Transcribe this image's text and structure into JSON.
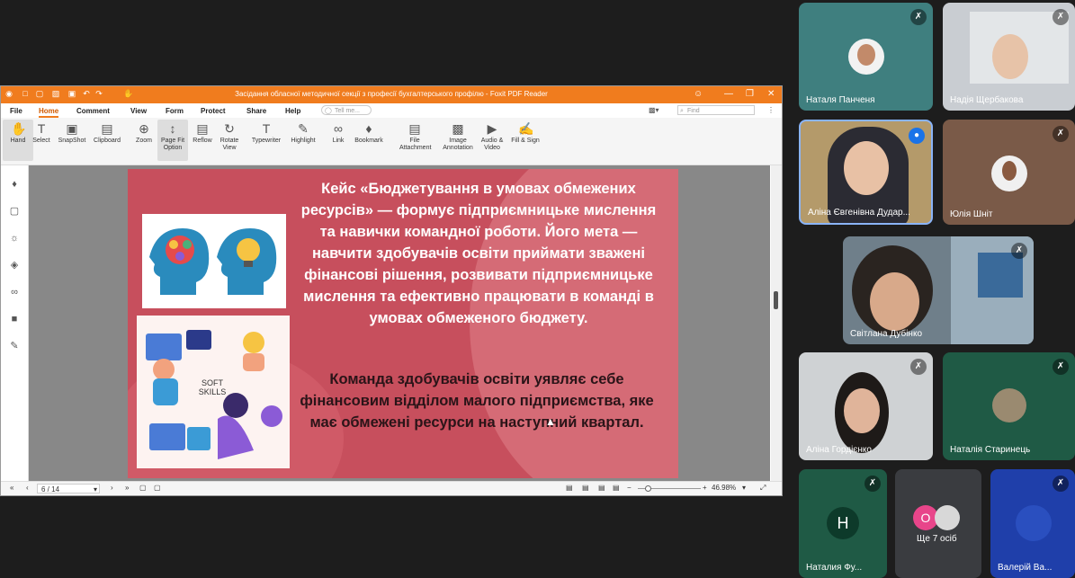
{
  "pdf": {
    "window_title": "Засідання обласної методичної секції з професії бухгалтерського профілю - Foxit PDF Reader",
    "menu": [
      "File",
      "Home",
      "Comment",
      "View",
      "Form",
      "Protect",
      "Share",
      "Help"
    ],
    "tell_me": "Tell me...",
    "find": "Find",
    "ribbon": [
      {
        "label": "Hand",
        "icon": "hand-icon"
      },
      {
        "label": "Select",
        "icon": "select-text-icon"
      },
      {
        "label": "SnapShot",
        "icon": "snapshot-icon"
      },
      {
        "label": "Clipboard",
        "icon": "clipboard-icon"
      },
      {
        "label": "Zoom",
        "icon": "zoom-icon"
      },
      {
        "label": "Page Fit Option",
        "icon": "page-fit-icon"
      },
      {
        "label": "Reflow",
        "icon": "reflow-icon"
      },
      {
        "label": "Rotate View",
        "icon": "rotate-icon"
      },
      {
        "label": "Typewriter",
        "icon": "typewriter-icon"
      },
      {
        "label": "Highlight",
        "icon": "highlight-icon"
      },
      {
        "label": "Link",
        "icon": "link-icon"
      },
      {
        "label": "Bookmark",
        "icon": "bookmark-icon"
      },
      {
        "label": "File Attachment",
        "icon": "file-attachment-icon"
      },
      {
        "label": "Image Annotation",
        "icon": "image-annotation-icon"
      },
      {
        "label": "Audio & Video",
        "icon": "audio-video-icon"
      },
      {
        "label": "Fill & Sign",
        "icon": "fill-sign-icon"
      }
    ],
    "page_indicator": "6 / 14",
    "zoom": "46.98%",
    "slide": {
      "paragraph1": "Кейс «Бюджетування в умовах обмежених ресурсів» — формує підприємницьке мислення та навички командної роботи. Його мета — навчити здобувачів освіти приймати зважені фінансові рішення, розвивати підприємницьке мислення та ефективно працювати в команді в умовах обмеженого бюджету.",
      "paragraph2": "Команда здобувачів освіти уявляє себе фінансовим відділом малого підприємства, яке має обмежені ресурси на наступний квартал.",
      "illustration_text": "SOFT SKILLS"
    }
  },
  "participants": [
    {
      "name": "Наталя Панченя"
    },
    {
      "name": "Надія Щербакова"
    },
    {
      "name": "Аліна Євгенівна Дудар..."
    },
    {
      "name": "Юлія Шніт"
    },
    {
      "name": "Світлана Дубінко"
    },
    {
      "name": "Аліна Гордієнко"
    },
    {
      "name": "Наталія Старинець"
    },
    {
      "name": "Наталия Фу...",
      "initial": "Н"
    },
    {
      "name": "Ще 7 осіб",
      "initial": "О"
    },
    {
      "name": "Валерій Ва..."
    }
  ],
  "colors": {
    "accent": "#f07c1e",
    "slide_bg": "#c74f5d",
    "tile_green": "#1f5a45",
    "tile_blue": "#1f3faa"
  }
}
